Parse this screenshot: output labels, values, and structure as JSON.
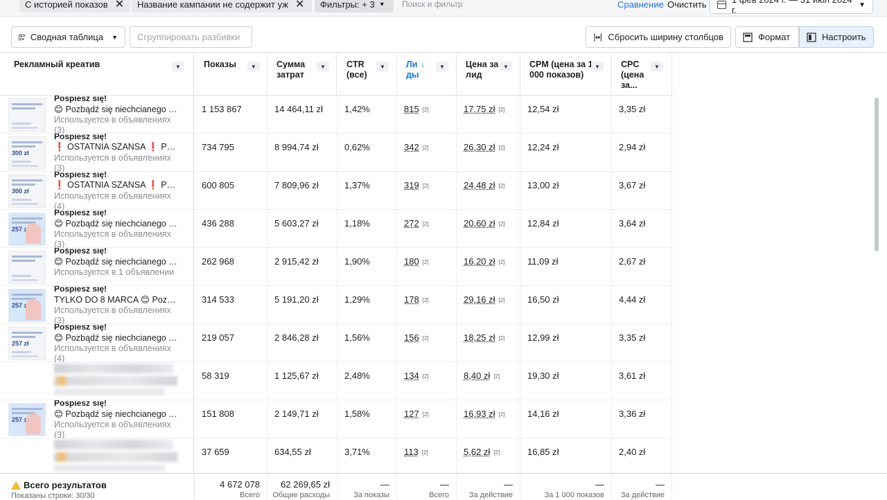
{
  "filters": {
    "chip1": "С историей показов",
    "chip2": "Название кампании не содержит уж",
    "filter_chip": "Фильтры: + 3",
    "search_placeholder": "Поиск и фильтр",
    "compare": "Сравнение",
    "clear": "Очистить",
    "date_range": "1 фев 2024 г. — 31 июл 2024 г."
  },
  "toolbar": {
    "pivot": "Сводная таблица",
    "group": "Сгруппировать разбивки",
    "reset_width": "Сбросить ширину столбцов",
    "format": "Формат",
    "customize": "Настроить"
  },
  "columns": {
    "creative": "Рекламный креатив",
    "impressions": "Показы",
    "spend": "Сумма затрат",
    "ctr": "CTR (все)",
    "leads": "Ли ды",
    "cpl": "Цена за лид",
    "cpm": "CPM (цена за 1 000 показов)",
    "cpc": "CPC (цена за..."
  },
  "ref_mark": "[2]",
  "rows": [
    {
      "title": "Pospiesz się!",
      "text": "😊 Pozbądź się niechcianego o...",
      "used": "Используется в объявлениях",
      "count": "(3)",
      "thumb": "light",
      "price": "",
      "impressions": "1 153 867",
      "spend": "14 464,11 zł",
      "ctr": "1,42%",
      "leads": "815",
      "cpl": "17,75 zł",
      "cpm": "12,54 zł",
      "cpc": "3,35 zł"
    },
    {
      "title": "Pospiesz się!",
      "text": "❗ OSTATNIA SZANSA ❗ Pach...",
      "used": "Используется в объявлениях",
      "count": "(3)",
      "thumb": "light",
      "price": "300 zł",
      "impressions": "734 795",
      "spend": "8 994,74 zł",
      "ctr": "0,62%",
      "leads": "342",
      "cpl": "26,30 zł",
      "cpm": "12,24 zł",
      "cpc": "2,94 zł"
    },
    {
      "title": "Pospiesz się!",
      "text": "❗ OSTATNIA SZANSA ❗ Pach...",
      "used": "Используется в объявлениях",
      "count": "(4)",
      "thumb": "light",
      "price": "300 zł",
      "impressions": "600 805",
      "spend": "7 809,96 zł",
      "ctr": "1,37%",
      "leads": "319",
      "cpl": "24,48 zł",
      "cpm": "13,00 zł",
      "cpc": "3,67 zł"
    },
    {
      "title": "Pospiesz się!",
      "text": "😊 Pozbądź się niechcianego o...",
      "used": "Используется в объявлениях",
      "count": "(3)",
      "thumb": "blue",
      "price": "257 zł",
      "impressions": "436 288",
      "spend": "5 603,27 zł",
      "ctr": "1,18%",
      "leads": "272",
      "cpl": "20,60 zł",
      "cpm": "12,84 zł",
      "cpc": "3,64 zł"
    },
    {
      "title": "Pośpiesz się!",
      "text": "😊 Pozbądź się niechcianego o...",
      "used": "Используется в 1 объявлении",
      "count": "",
      "thumb": "light",
      "price": "",
      "impressions": "262 968",
      "spend": "2 915,42 zł",
      "ctr": "1,90%",
      "leads": "180",
      "cpl": "16,20 zł",
      "cpm": "11,09 zł",
      "cpc": "2,67 zł"
    },
    {
      "title": "Pospiesz się!",
      "text": "TYLKO DO 8 MARCA 😊 Pozbąd...",
      "used": "Используется в объявлениях",
      "count": "(3)",
      "thumb": "blue",
      "price": "257 zł",
      "impressions": "314 533",
      "spend": "5 191,20 zł",
      "ctr": "1,29%",
      "leads": "178",
      "cpl": "29,16 zł",
      "cpm": "16,50 zł",
      "cpc": "4,44 zł"
    },
    {
      "title": "Pospiesz się!",
      "text": "😊 Pozbądź się niechcianego o...",
      "used": "Используется в объявлениях",
      "count": "(4)",
      "thumb": "light",
      "price": "257 zł",
      "impressions": "219 057",
      "spend": "2 846,28 zł",
      "ctr": "1,56%",
      "leads": "156",
      "cpl": "18,25 zł",
      "cpm": "12,99 zł",
      "cpc": "3,35 zł"
    },
    {
      "title": "",
      "text": "",
      "used": "",
      "count": "",
      "thumb": "none",
      "price": "",
      "impressions": "58 319",
      "spend": "1 125,67 zł",
      "ctr": "2,48%",
      "leads": "134",
      "cpl": "8,40 zł",
      "cpm": "19,30 zł",
      "cpc": "3,61 zł"
    },
    {
      "title": "Pospiesz się!",
      "text": "😊 Pozbądź się niechcianego o...",
      "used": "Используется в объявлениях",
      "count": "(3)",
      "thumb": "blue",
      "price": "257 zł",
      "impressions": "151 808",
      "spend": "2 149,71 zł",
      "ctr": "1,58%",
      "leads": "127",
      "cpl": "16,93 zł",
      "cpm": "14,16 zł",
      "cpc": "3,36 zł"
    },
    {
      "title": "",
      "text": "",
      "used": "",
      "count": "",
      "thumb": "none",
      "price": "",
      "impressions": "37 659",
      "spend": "634,55 zł",
      "ctr": "3,71%",
      "leads": "113",
      "cpl": "5,62 zł",
      "cpm": "16,85 zł",
      "cpc": "2,40 zł"
    }
  ],
  "totals": {
    "title": "Всего результатов",
    "rows_shown": "Показаны строки: 30/30",
    "impressions": "4 672 078",
    "impressions_label": "Всего",
    "spend": "62 269,65 zł",
    "spend_label": "Общие расходы",
    "ctr": "—",
    "ctr_label": "За показы",
    "leads": "—",
    "leads_label": "Всего",
    "cpl": "—",
    "cpl_label": "За действие",
    "cpm": "—",
    "cpm_label": "За 1 000 показов",
    "cpc": "—",
    "cpc_label": "За действие"
  }
}
